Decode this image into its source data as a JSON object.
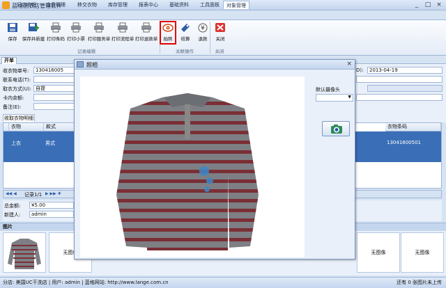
{
  "app": {
    "title": "蓝格洗衣店管理软件",
    "window_controls": [
      "_",
      "□",
      "×"
    ]
  },
  "menu": [
    {
      "label": "门店收银"
    },
    {
      "label": "会员管理"
    },
    {
      "label": "移交衣物"
    },
    {
      "label": "库存管理"
    },
    {
      "label": "报表中心"
    },
    {
      "label": "基础资料"
    },
    {
      "label": "工具面板"
    },
    {
      "label": "对象管理",
      "active": true
    }
  ],
  "ribbon": {
    "buttons": [
      {
        "label": "保存",
        "icon": "save-icon"
      },
      {
        "label": "保存并新建",
        "icon": "save-new-icon"
      },
      {
        "label": "打印条码",
        "icon": "printer-icon"
      },
      {
        "label": "打印小票",
        "icon": "printer-icon"
      },
      {
        "label": "打印服务单",
        "icon": "printer-icon"
      },
      {
        "label": "打印流程单",
        "icon": "printer-icon"
      },
      {
        "label": "打印退款单",
        "icon": "printer-icon"
      },
      {
        "label": "拍照",
        "icon": "camera-eye-icon"
      },
      {
        "label": "结算",
        "icon": "settle-icon"
      },
      {
        "label": "退款",
        "icon": "refund-icon"
      },
      {
        "label": "关闭",
        "icon": "close-icon"
      }
    ],
    "groups": [
      "记录编辑",
      "关联操作",
      "关闭"
    ],
    "highlight_color": "#e00000"
  },
  "doc_tab": "开单",
  "form": {
    "clothes_no_label": "收衣物单号:",
    "clothes_no": "130416005",
    "phone_label": "联系电话(T):",
    "phone": "",
    "pickup_label": "取衣方式(U):",
    "pickup": "自提",
    "card_label": "卡内余额:",
    "card": "",
    "note_label": "备注(E):",
    "note": "",
    "date_label": "D):",
    "date": "2013-04-19"
  },
  "grid": {
    "tab": "收取衣物明细",
    "columns": [
      "衣物",
      "款式",
      "衣物条码"
    ],
    "rows": [
      {
        "item": "上衣",
        "style": "男式",
        "barcode": "13041600501"
      }
    ]
  },
  "nav": {
    "record": "记录1/1"
  },
  "totals": {
    "total_label": "总金额:",
    "total": "¥5.00",
    "creator_label": "新建人:",
    "creator": "admin"
  },
  "images": {
    "title": "图片",
    "no_image": "无图像",
    "count": 8
  },
  "status": {
    "text": "分店: 美国UC干洗店 | 用户: admin | 蓝格网站: http://www.lange.com.cn",
    "right": "还有 0 张图片未上传"
  },
  "dialog": {
    "title": "照相",
    "camera_label": "默认摄像头",
    "camera_value": "",
    "capture_icon": "camera-icon",
    "close_icon": "close-icon",
    "subject": "striped long-sleeve polo shirt",
    "colors": {
      "grey": "#7d7f84",
      "red": "#7a2f35",
      "stain": "#3d86c6"
    }
  }
}
